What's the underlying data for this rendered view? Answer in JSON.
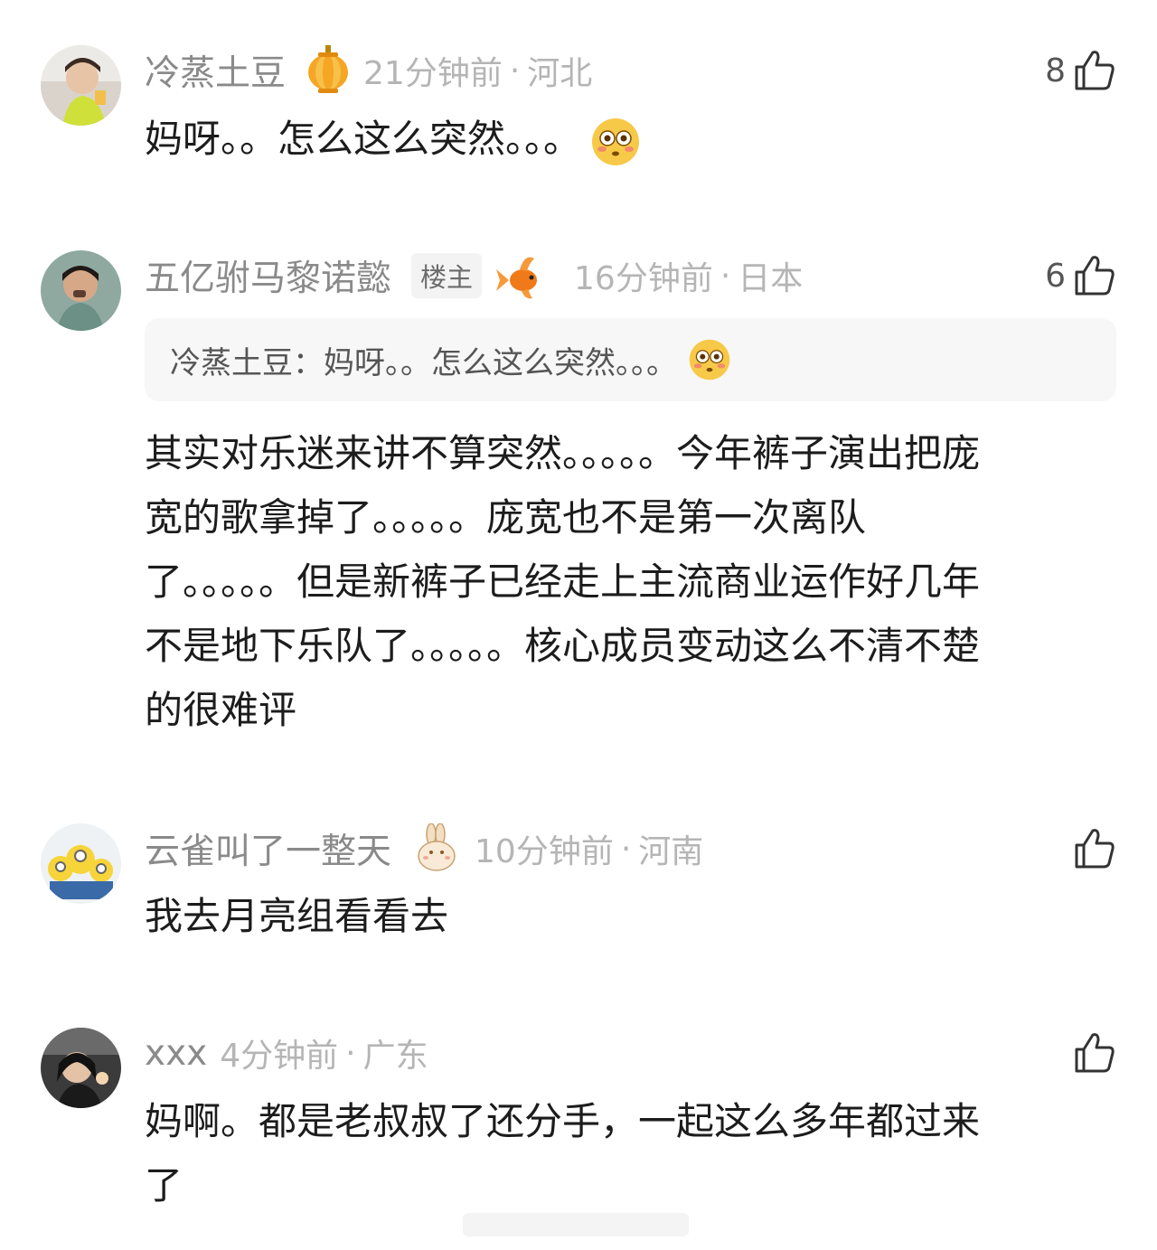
{
  "comments": [
    {
      "username": "冷蒸土豆",
      "badge": "lantern-badge-icon",
      "time": "21分钟前",
      "location": "河北",
      "likes": "8",
      "text": "妈呀。。怎么这么突然。。。",
      "emoji": "flushed-face-emoji"
    },
    {
      "username": "五亿驸马黎诺懿",
      "op_label": "楼主",
      "badge": "goldfish-badge-icon",
      "time": "16分钟前",
      "location": "日本",
      "likes": "6",
      "reply_quote": "冷蒸土豆：妈呀。。怎么这么突然。。。",
      "reply_emoji": "flushed-face-emoji",
      "text_lines": [
        "其实对乐迷来讲不算突然。。。。。今年裤子演出把庞",
        "宽的歌拿掉了。。。。。庞宽也不是第一次离队",
        "了。。。。。但是新裤子已经走上主流商业运作好几年",
        "不是地下乐队了。。。。。核心成员变动这么不清不楚",
        "的很难评"
      ]
    },
    {
      "username": "云雀叫了一整天",
      "badge": "rabbit-badge-icon",
      "time": "10分钟前",
      "location": "河南",
      "text": "我去月亮组看看去"
    },
    {
      "username": "xxx",
      "time": "4分钟前",
      "location": "广东",
      "text_lines": [
        "妈啊。都是老叔叔了还分手，一起这么多年都过来",
        "了"
      ]
    }
  ],
  "separator": "·",
  "colors": {
    "username": "#8a8a8a",
    "meta": "#b5b5b5",
    "body": "#1c1c1c",
    "reply_bg": "#f7f7f7"
  }
}
